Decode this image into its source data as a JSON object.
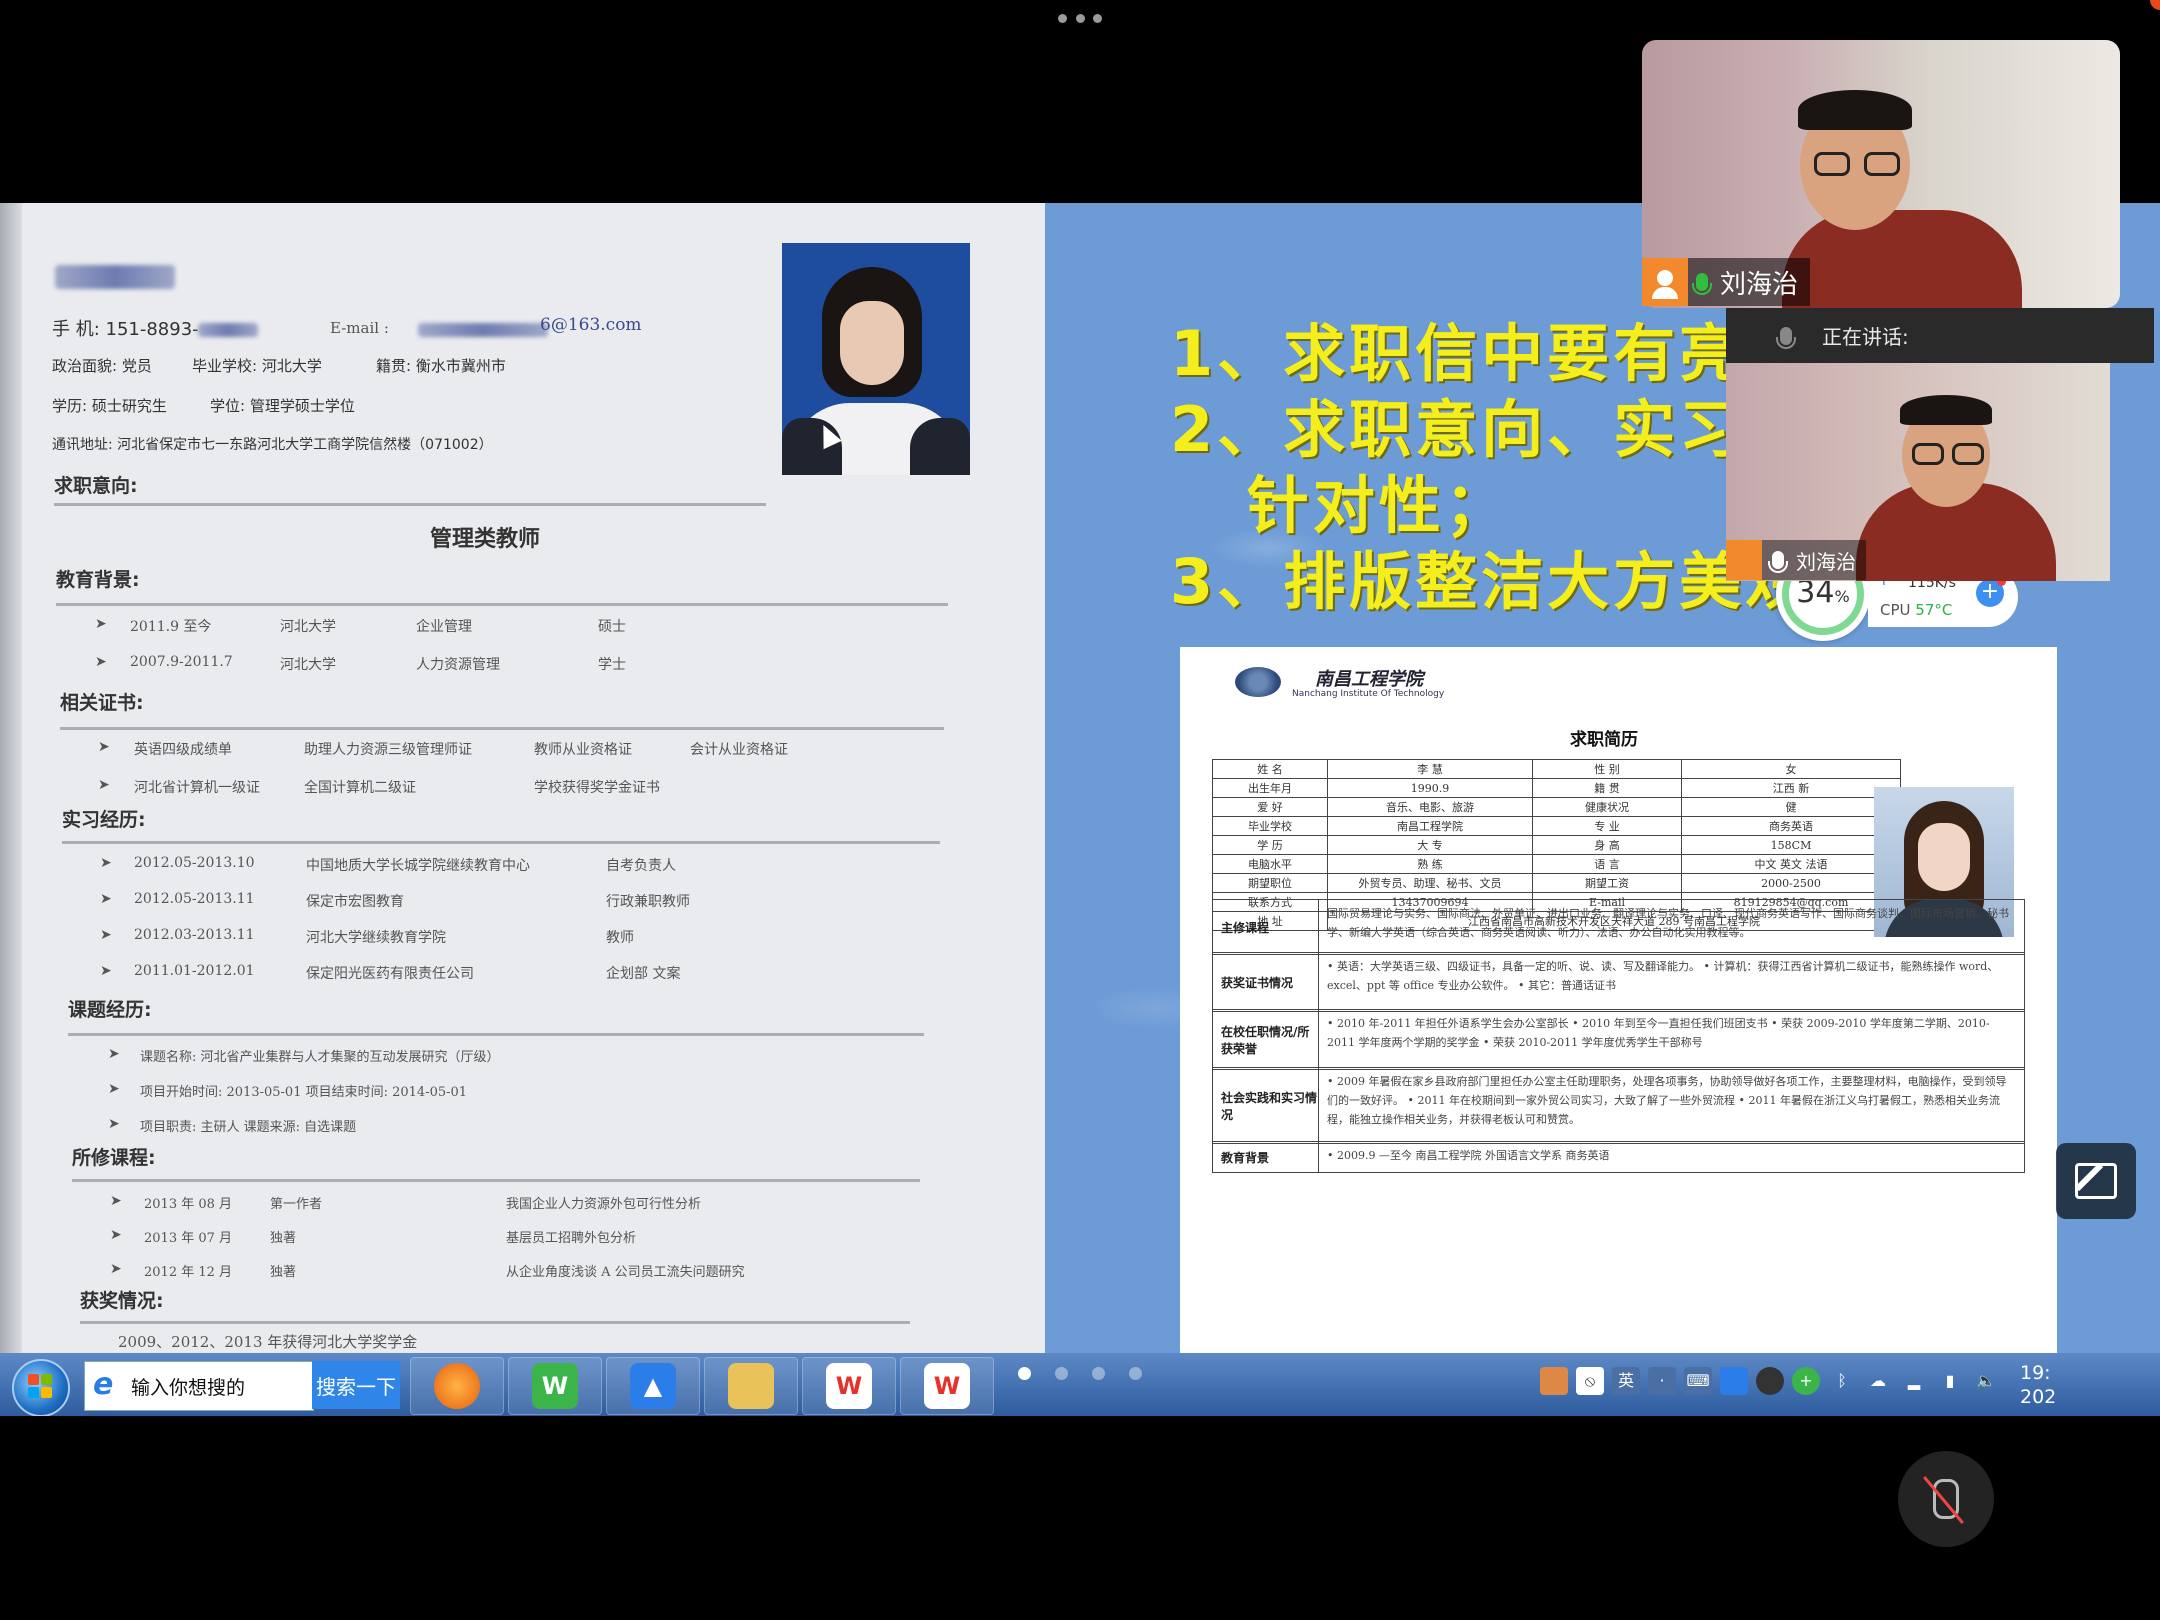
{
  "meeting": {
    "speaker_name": "刘海治",
    "self_name": "刘海治",
    "speaking_label": "正在讲话:"
  },
  "paper_resume": {
    "phone": "手 机: 151-8893-",
    "email_label": "E-mail :",
    "email_suffix": "6@163.com",
    "politics": "政治面貌: 党员",
    "school": "毕业学校: 河北大学",
    "native": "籍贯: 衡水市冀州市",
    "degree_edu": "学历: 硕士研究生",
    "degree": "学位: 管理学硕士学位",
    "address": "通讯地址: 河北省保定市七一东路河北大学工商学院信然楼（071002）",
    "intent_title": "求职意向:",
    "intent_value": "管理类教师",
    "edu_title": "教育背景:",
    "edu": [
      [
        "2011.9 至今",
        "河北大学",
        "企业管理",
        "硕士"
      ],
      [
        "2007.9-2011.7",
        "河北大学",
        "人力资源管理",
        "学士"
      ]
    ],
    "cert_title": "相关证书:",
    "certs": [
      [
        "英语四级成绩单",
        "助理人力资源三级管理师证",
        "教师从业资格证",
        "会计从业资格证"
      ],
      [
        "河北省计算机一级证",
        "全国计算机二级证",
        "学校获得奖学金证书",
        ""
      ]
    ],
    "intern_title": "实习经历:",
    "interns": [
      [
        "2012.05-2013.10",
        "中国地质大学长城学院继续教育中心",
        "自考负责人"
      ],
      [
        "2012.05-2013.11",
        "保定市宏图教育",
        "行政兼职教师"
      ],
      [
        "2012.03-2013.11",
        "河北大学继续教育学院",
        "教师"
      ],
      [
        "2011.01-2012.01",
        "保定阳光医药有限责任公司",
        "企划部  文案"
      ]
    ],
    "project_title": "课题经历:",
    "projects": [
      "课题名称: 河北省产业集群与人才集聚的互动发展研究（厅级）",
      "项目开始时间: 2013-05-01  项目结束时间: 2014-05-01",
      "项目职责: 主研人        课题来源: 自选课题"
    ],
    "course_title": "所修课程:",
    "courses": [
      [
        "2013 年 08 月",
        "第一作者",
        "我国企业人力资源外包可行性分析"
      ],
      [
        "2013 年 07 月",
        "独著",
        "基层员工招聘外包分析"
      ],
      [
        "2012 年 12 月",
        "独著",
        "从企业角度浅谈 A 公司员工流失问题研究"
      ]
    ],
    "award_title": "获奖情况:",
    "award": "2009、2012、2013 年获得河北大学奖学金"
  },
  "slide": {
    "lines": [
      "1、求职信中要有亮",
      "2、求职意向、实习",
      "   针对性；",
      "3、排版整洁大方美观。"
    ],
    "resume": {
      "school_cn": "南昌工程学院",
      "school_en": "Nanchang Institute Of Technology",
      "title": "求职简历",
      "rows": [
        [
          "姓  名",
          "李  慧",
          "性  别",
          "女"
        ],
        [
          "出生年月",
          "1990.9",
          "籍  贯",
          "江西 新"
        ],
        [
          "爱  好",
          "音乐、电影、旅游",
          "健康状况",
          "健"
        ],
        [
          "毕业学校",
          "南昌工程学院",
          "专  业",
          "商务英语"
        ],
        [
          "学  历",
          "大  专",
          "身  高",
          "158CM"
        ],
        [
          "电脑水平",
          "熟  练",
          "语  言",
          "中文 英文 法语"
        ],
        [
          "期望职位",
          "外贸专员、助理、秘书、文员",
          "期望工资",
          "2000-2500"
        ],
        [
          "联系方式",
          "13437009694",
          "E-mail",
          "819129854@qq.com"
        ]
      ],
      "address_label": "地  址",
      "address": "江西省南昌市高新技术开发区天祥大道 289 号南昌工程学院",
      "sections": [
        {
          "k": "主修课程",
          "v": "国际贸易理论与实务、国际商法、外贸单证、进出口业务、翻译理论与实务、口译、现代商务英语写作、国际商务谈判、国际市场营销、秘书学、新编大学英语（综合英语、商务英语阅读、听力）、法语、办公自动化实用教程等。"
        },
        {
          "k": "获奖证书情况",
          "v": "• 英语：大学英语三级、四级证书，具备一定的听、说、读、写及翻译能力。 • 计算机：获得江西省计算机二级证书，能熟练操作 word、excel、ppt 等 office 专业办公软件。 • 其它：普通话证书"
        },
        {
          "k": "在校任职情况/所获荣誉",
          "v": "• 2010 年-2011 年担任外语系学生会办公室部长 • 2010 年到至今一直担任我们班团支书 • 荣获 2009-2010 学年度第二学期、2010-2011 学年度两个学期的奖学金 • 荣获 2010-2011 学年度优秀学生干部称号"
        },
        {
          "k": "社会实践和实习情况",
          "v": "• 2009 年暑假在家乡县政府部门里担任办公室主任助理职务，处理各项事务，协助领导做好各项工作，主要整理材料，电脑操作，受到领导们的一致好评。 • 2011 年在校期间到一家外贸公司实习，大致了解了一些外贸流程 • 2011 年暑假在浙江义乌打暑假工，熟悉相关业务流程，能独立操作相关业务，并获得老板认可和赞赏。"
        },
        {
          "k": "教育背景",
          "v": "• 2009.9 —至今   南昌工程学院  外国语言文学系  商务英语"
        }
      ]
    }
  },
  "monitor": {
    "percent": "34",
    "percent_unit": "%",
    "net_speed": "115K/s",
    "cpu_label": "CPU",
    "cpu_temp": "57°C"
  },
  "taskbar": {
    "search_placeholder": "输入你想搜的",
    "search_button": "搜索一下",
    "ime": "英",
    "clock_line1": "19:",
    "clock_line2": "202"
  }
}
